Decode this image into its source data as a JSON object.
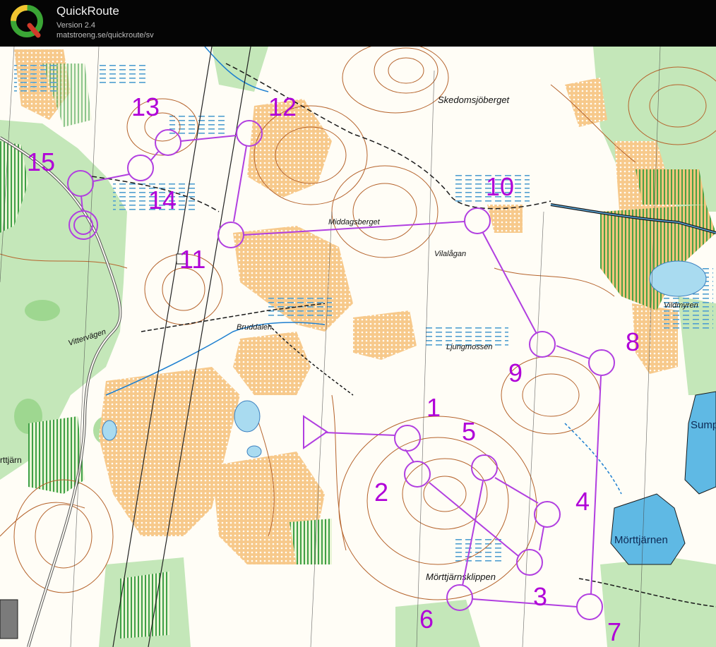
{
  "app": {
    "title": "QuickRoute",
    "version": "Version 2.4",
    "url": "matstroeng.se/quickroute/sv"
  },
  "colors": {
    "course": "#b13fe0",
    "control_number": "#b000d8",
    "open_land": "#f7c98b",
    "forest": "#ffffff",
    "green": "#bfe5b4",
    "water": "#6cc3e6",
    "marsh": "#4f9fd0",
    "contour": "#b5632c"
  },
  "course": {
    "start": "triangle",
    "controls": [
      "1",
      "2",
      "3",
      "4",
      "5",
      "6",
      "7",
      "8",
      "9",
      "10",
      "11",
      "12",
      "13",
      "14",
      "15"
    ]
  },
  "place_names": {
    "skedomsjoberget": "Skedomsjöberget",
    "middagsberget": "Middagsberget",
    "vilalagan": "Vilalågan",
    "bruddalen": "Bruddalen",
    "ljungmossen": "Ljungmossen",
    "morttjarnsklippen": "Mörttjärnsklippen",
    "morttjarnen": "Mörttjärnen",
    "vildmyren": "Vildmyren",
    "sump": "Sump",
    "tjarn": "rttjärn",
    "vittervagen": "Vittervägen"
  }
}
